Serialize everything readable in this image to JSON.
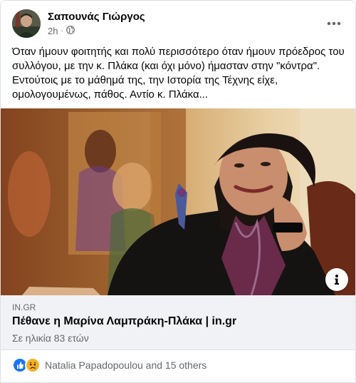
{
  "post": {
    "author": "Σαπουνάς Γιώργος",
    "time": "2h",
    "dot": "·",
    "message": "Όταν ήμουν φοιτητής και πολύ περισσότερο όταν ήμουν πρόεδρος του συλλόγου, με την κ. Πλάκα (και όχι μόνο) ήμασταν στην \"κόντρα\". Εντούτοις με το μάθημά της, την Ιστορία της Τέχνης είχε, ομολογουμένως, πάθος. Αντίο κ. Πλάκα..."
  },
  "link": {
    "domain": "IN.GR",
    "title": "Πέθανε η Μαρίνα Λαμπράκη-Πλάκα | in.gr",
    "subtitle": "Σε ηλικία 83 ετών"
  },
  "reactions": {
    "summary": "Natalia Papadopoulou and 15 others",
    "icons": [
      "like-reaction-icon",
      "sad-reaction-icon"
    ]
  },
  "colors": {
    "like_blue": "#1877f2",
    "sad_yellow": "#f7b125",
    "secondary_text": "#65676b",
    "preview_bg": "#f0f2f5"
  }
}
